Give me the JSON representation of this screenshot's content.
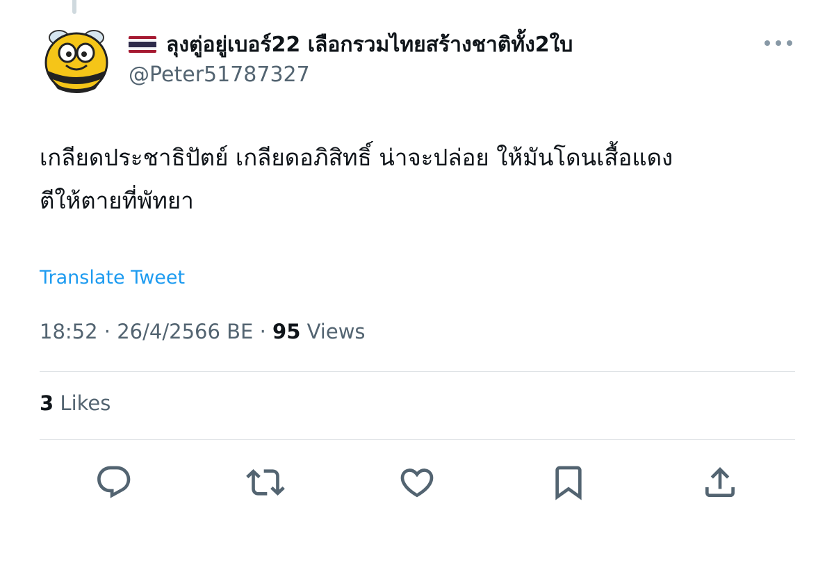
{
  "tweet": {
    "author": {
      "display_name": "ลุงตู่อยู่เบอร์22 เลือกรวมไทยสร้างชาติทั้ง2ใบ",
      "handle": "@Peter51787327",
      "flag_icon": "thailand-flag-icon",
      "avatar_icon": "bee-avatar-icon"
    },
    "text": "เกลียดประชาธิปัตย์ เกลียดอภิสิทธิ์ น่าจะปล่อย ให้มันโดนเสื้อแดง\nตีให้ตายที่พัทยา",
    "translate_label": "Translate Tweet",
    "time": "18:52",
    "separator": "·",
    "date": "26/4/2566 BE",
    "views_count": "95",
    "views_label": "Views",
    "likes_count": "3",
    "likes_label": "Likes"
  },
  "actions": {
    "reply_icon": "reply-icon",
    "retweet_icon": "retweet-icon",
    "like_icon": "heart-icon",
    "bookmark_icon": "bookmark-icon",
    "share_icon": "share-icon"
  },
  "colors": {
    "link": "#1d9bf0",
    "secondary_text": "#536471",
    "primary_text": "#0f1419",
    "divider": "#dfe3e6",
    "icon": "#536471"
  }
}
